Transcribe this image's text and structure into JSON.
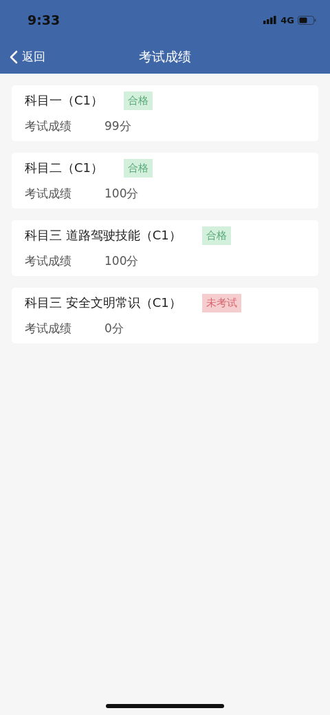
{
  "status_bar": {
    "time": "9:33",
    "network": "4G"
  },
  "nav": {
    "back": "返回",
    "title": "考试成绩"
  },
  "results": [
    {
      "subject": "科目一（C1）",
      "status": {
        "kind": "pass",
        "label": "合格"
      },
      "score_label": "考试成绩",
      "score": "99分"
    },
    {
      "subject": "科目二（C1）",
      "status": {
        "kind": "pass",
        "label": "合格"
      },
      "score_label": "考试成绩",
      "score": "100分"
    },
    {
      "subject": "科目三 道路驾驶技能（C1）",
      "status": {
        "kind": "pass",
        "label": "合格"
      },
      "score_label": "考试成绩",
      "score": "100分"
    },
    {
      "subject": "科目三 安全文明常识（C1）",
      "status": {
        "kind": "absent",
        "label": "未考试"
      },
      "score_label": "考试成绩",
      "score": "0分"
    }
  ]
}
